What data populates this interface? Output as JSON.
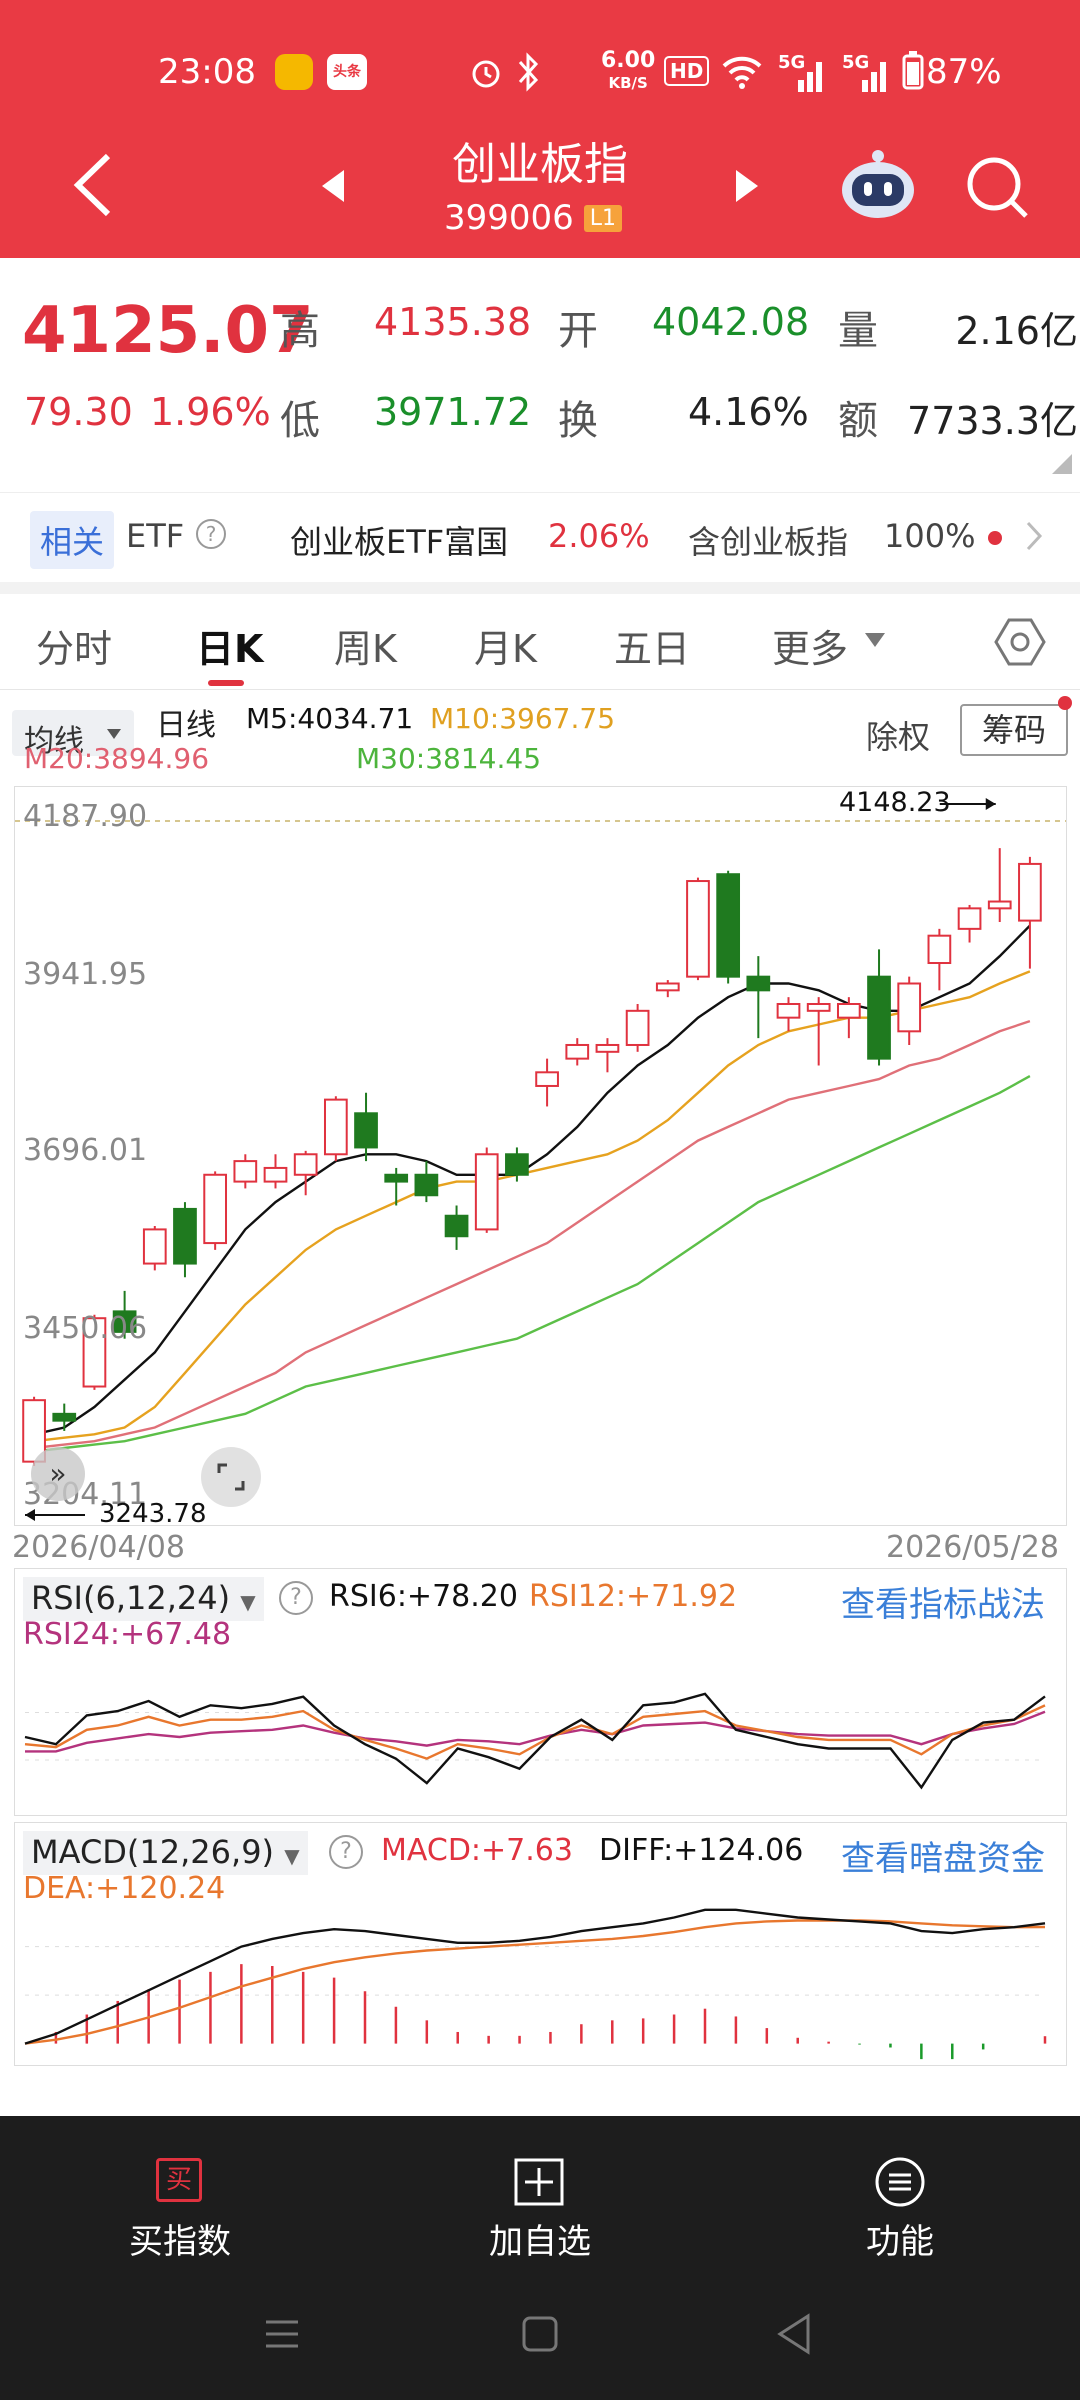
{
  "status_bar": {
    "time": "23:08",
    "weibo_icon": "weibo-icon",
    "toutiao_label": "头条",
    "speed": "6.00",
    "speed_unit": "KB/S",
    "hd_label": "HD",
    "net1": "5G",
    "net2": "5G",
    "battery": "87%"
  },
  "header": {
    "title": "创业板指",
    "code": "399006",
    "level_badge": "L1"
  },
  "quote": {
    "price": "4125.07",
    "change": "79.30",
    "change_pct": "1.96%",
    "high_label": "高",
    "high": "4135.38",
    "open_label": "开",
    "open": "4042.08",
    "vol_label": "量",
    "vol": "2.16亿",
    "low_label": "低",
    "low": "3971.72",
    "turnover_label": "换",
    "turnover": "4.16%",
    "amount_label": "额",
    "amount": "7733.3亿"
  },
  "etf_row": {
    "tag": "相关",
    "etf": "ETF",
    "help": "?",
    "name": "创业板ETF富国",
    "pct": "2.06%",
    "contains": "含创业板指",
    "weight": "100%"
  },
  "tabs": [
    {
      "label": "分时"
    },
    {
      "label": "日K"
    },
    {
      "label": "周K"
    },
    {
      "label": "月K"
    },
    {
      "label": "五日"
    },
    {
      "label": "更多"
    }
  ],
  "ma_bar": {
    "selector": "均线",
    "period": "日线",
    "m5": "M5:4034.71",
    "m10": "M10:3967.75",
    "m20": "M20:3894.96",
    "m30": "M30:3814.45",
    "exright": "除权",
    "chips": "筹码"
  },
  "colors": {
    "up": "#e0323f",
    "down": "#1f7a1f",
    "m5": "#111111",
    "m10": "#e6a21f",
    "m20": "#e07078",
    "m30": "#5cbf48"
  },
  "chart_data": {
    "type": "candlestick",
    "y_labels": [
      "4187.90",
      "3941.95",
      "3696.01",
      "3450.06",
      "3204.11"
    ],
    "ylim": [
      3204.11,
      4187.9
    ],
    "max_annotation": "4148.23",
    "min_annotation": "3243.78",
    "start_date": "2026/04/08",
    "end_date": "2026/05/28",
    "candles": [
      [
        3250,
        3340,
        3243.78,
        3345
      ],
      [
        3320,
        3310,
        3295,
        3335
      ],
      [
        3360,
        3460,
        3355,
        3465
      ],
      [
        3470,
        3440,
        3430,
        3500
      ],
      [
        3540,
        3590,
        3530,
        3595
      ],
      [
        3620,
        3540,
        3520,
        3630
      ],
      [
        3570,
        3670,
        3560,
        3675
      ],
      [
        3660,
        3690,
        3650,
        3700
      ],
      [
        3660,
        3680,
        3650,
        3700
      ],
      [
        3670,
        3700,
        3640,
        3705
      ],
      [
        3700,
        3780,
        3690,
        3785
      ],
      [
        3760,
        3710,
        3690,
        3790
      ],
      [
        3670,
        3660,
        3625,
        3680
      ],
      [
        3670,
        3640,
        3630,
        3690
      ],
      [
        3610,
        3580,
        3560,
        3625
      ],
      [
        3590,
        3700,
        3585,
        3710
      ],
      [
        3700,
        3670,
        3660,
        3710
      ],
      [
        3800,
        3820,
        3770,
        3840
      ],
      [
        3840,
        3860,
        3830,
        3870
      ],
      [
        3850,
        3860,
        3820,
        3870
      ],
      [
        3860,
        3910,
        3850,
        3920
      ],
      [
        3940,
        3950,
        3930,
        3955
      ],
      [
        3960,
        4100,
        3955,
        4105
      ],
      [
        4110,
        3960,
        3950,
        4115
      ],
      [
        3960,
        3940,
        3870,
        3990
      ],
      [
        3900,
        3920,
        3880,
        3930
      ],
      [
        3910,
        3920,
        3830,
        3930
      ],
      [
        3900,
        3920,
        3870,
        3930
      ],
      [
        3960,
        3840,
        3830,
        4000
      ],
      [
        3880,
        3950,
        3860,
        3960
      ],
      [
        3980,
        4020,
        3940,
        4030
      ],
      [
        4030,
        4060,
        4010,
        4065
      ],
      [
        4060,
        4070,
        4040,
        4148.23
      ],
      [
        4042.08,
        4125.07,
        3971.72,
        4135.38
      ]
    ],
    "ma": {
      "m5": [
        3290,
        3300,
        3330,
        3370,
        3410,
        3470,
        3530,
        3590,
        3630,
        3660,
        3690,
        3700,
        3700,
        3690,
        3670,
        3670,
        3670,
        3700,
        3740,
        3790,
        3830,
        3860,
        3900,
        3930,
        3950,
        3950,
        3940,
        3920,
        3910,
        3910,
        3930,
        3950,
        3990,
        4034.71
      ],
      "m10": [
        3280,
        3285,
        3290,
        3300,
        3330,
        3380,
        3430,
        3480,
        3520,
        3560,
        3590,
        3610,
        3630,
        3650,
        3660,
        3660,
        3670,
        3680,
        3690,
        3700,
        3720,
        3750,
        3790,
        3830,
        3860,
        3880,
        3890,
        3900,
        3900,
        3910,
        3920,
        3930,
        3950,
        3967.75
      ],
      "m20": [
        3270,
        3275,
        3280,
        3290,
        3300,
        3320,
        3340,
        3360,
        3380,
        3410,
        3430,
        3450,
        3470,
        3490,
        3510,
        3530,
        3550,
        3570,
        3600,
        3630,
        3660,
        3690,
        3720,
        3740,
        3760,
        3780,
        3790,
        3800,
        3810,
        3830,
        3840,
        3860,
        3880,
        3894.96
      ],
      "m30": [
        3265,
        3270,
        3275,
        3280,
        3290,
        3300,
        3310,
        3320,
        3340,
        3360,
        3370,
        3380,
        3390,
        3400,
        3410,
        3420,
        3430,
        3450,
        3470,
        3490,
        3510,
        3540,
        3570,
        3600,
        3630,
        3650,
        3670,
        3690,
        3710,
        3730,
        3750,
        3770,
        3790,
        3814.45
      ]
    }
  },
  "rsi": {
    "title": "RSI(6,12,24)",
    "rsi6": "RSI6:+78.20",
    "rsi12": "RSI12:+71.92",
    "rsi24": "RSI24:+67.48",
    "link": "查看指标战法",
    "rsi6_vals": [
      50,
      45,
      65,
      68,
      75,
      64,
      72,
      70,
      73,
      78,
      58,
      45,
      35,
      18,
      42,
      36,
      28,
      50,
      62,
      48,
      72,
      74,
      80,
      55,
      50,
      45,
      42,
      42,
      42,
      15,
      48,
      60,
      62,
      78.2
    ],
    "rsi12_vals": [
      45,
      43,
      55,
      58,
      64,
      58,
      62,
      62,
      64,
      68,
      55,
      48,
      42,
      35,
      45,
      42,
      38,
      50,
      58,
      52,
      64,
      66,
      68,
      58,
      54,
      50,
      48,
      48,
      48,
      38,
      52,
      58,
      62,
      71.92
    ],
    "rsi24_vals": [
      40,
      40,
      46,
      49,
      52,
      50,
      53,
      54,
      55,
      58,
      53,
      49,
      47,
      44,
      48,
      47,
      45,
      51,
      55,
      52,
      58,
      59,
      60,
      56,
      54,
      52,
      51,
      51,
      51,
      45,
      52,
      56,
      59,
      67.48
    ]
  },
  "macd": {
    "title": "MACD(12,26,9)",
    "macd": "MACD:+7.63",
    "diff": "DIFF:+124.06",
    "dea": "DEA:+120.24",
    "link": "查看暗盘资金",
    "diff_vals": [
      0,
      10,
      25,
      40,
      55,
      70,
      85,
      100,
      108,
      114,
      118,
      116,
      112,
      108,
      104,
      104,
      106,
      110,
      116,
      120,
      124,
      130,
      138,
      138,
      134,
      130,
      128,
      126,
      124,
      116,
      114,
      118,
      120,
      124.06
    ],
    "dea_vals": [
      0,
      4,
      10,
      18,
      27,
      37,
      48,
      59,
      68,
      77,
      84,
      89,
      93,
      96,
      98,
      100,
      102,
      104,
      106,
      108,
      111,
      115,
      120,
      124,
      126,
      127,
      127,
      127,
      126,
      124,
      122,
      121,
      120,
      120.24
    ],
    "hist_vals": [
      0,
      12,
      30,
      44,
      56,
      66,
      74,
      82,
      80,
      74,
      68,
      54,
      38,
      24,
      12,
      8,
      8,
      12,
      20,
      24,
      26,
      30,
      36,
      28,
      16,
      6,
      2,
      -1,
      -4,
      -16,
      -16,
      -6,
      0,
      7.63
    ]
  },
  "bottom": {
    "buy_icon_label": "买",
    "buy": "买指数",
    "add": "加自选",
    "func": "功能"
  }
}
